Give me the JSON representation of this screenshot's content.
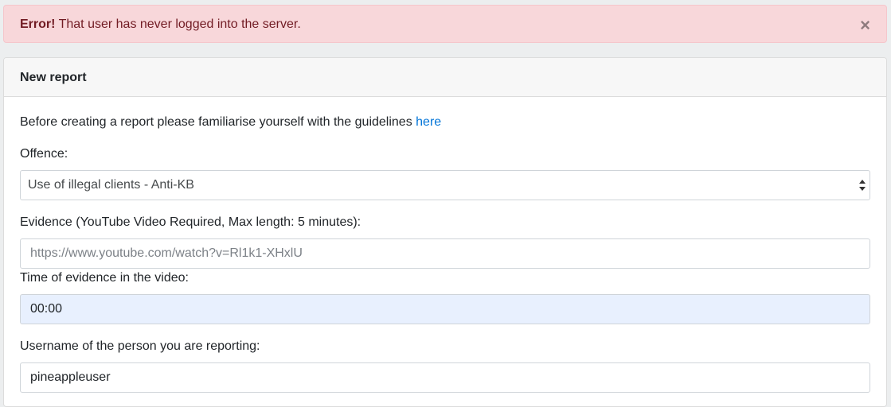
{
  "alert": {
    "strong": "Error!",
    "message": " That user has never logged into the server.",
    "close_label": "×"
  },
  "card": {
    "title": "New report",
    "intro_text": "Before creating a report please familiarise yourself with the guidelines ",
    "intro_link": "here",
    "offence_label": "Offence:",
    "offence_selected": "Use of illegal clients - Anti-KB",
    "evidence_label": "Evidence (YouTube Video Required, Max length: 5 minutes):",
    "evidence_placeholder": "https://www.youtube.com/watch?v=Rl1k1-XHxlU",
    "time_label": "Time of evidence in the video:",
    "time_value": "00:00",
    "username_label": "Username of the person you are reporting:",
    "username_value": "pineappleuser"
  },
  "colors": {
    "alert_bg": "#f8d7da",
    "alert_text": "#721c24",
    "link": "#0275d8",
    "autofill_bg": "#e8f0fe"
  },
  "icons": {
    "close": "close-icon",
    "select": "select-arrows-icon"
  }
}
